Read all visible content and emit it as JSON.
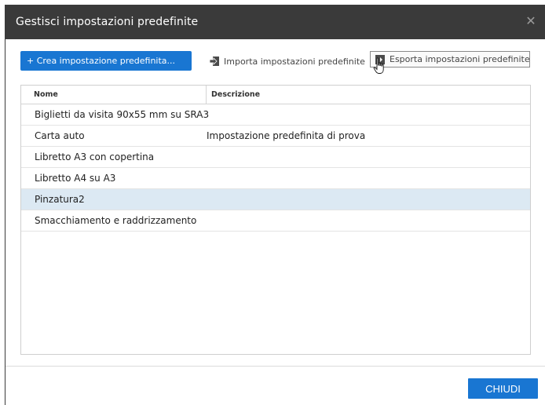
{
  "dialog": {
    "title": "Gestisci impostazioni predefinite",
    "close_icon": "close-icon"
  },
  "toolbar": {
    "create_label": "+ Crea impostazione predefinita...",
    "import_label": "Importa impostazioni predefinite",
    "import_icon": "import-icon",
    "export_label": "Esporta impostazioni predefinite",
    "export_icon": "export-icon"
  },
  "table": {
    "columns": [
      "Nome",
      "Descrizione"
    ],
    "rows": [
      {
        "name": "Biglietti da visita 90x55 mm su SRA3",
        "description": ""
      },
      {
        "name": "Carta auto",
        "description": "Impostazione predefinita di prova"
      },
      {
        "name": "Libretto A3 con copertina",
        "description": ""
      },
      {
        "name": "Libretto A4 su A3",
        "description": ""
      },
      {
        "name": "Pinzatura2",
        "description": "",
        "selected": true
      },
      {
        "name": "Smacchiamento e raddrizzamento",
        "description": ""
      }
    ]
  },
  "footer": {
    "close_label": "CHIUDI"
  },
  "colors": {
    "titlebar": "#3a3a3a",
    "primary": "#1976d2",
    "selected_row": "#dce9f3"
  }
}
